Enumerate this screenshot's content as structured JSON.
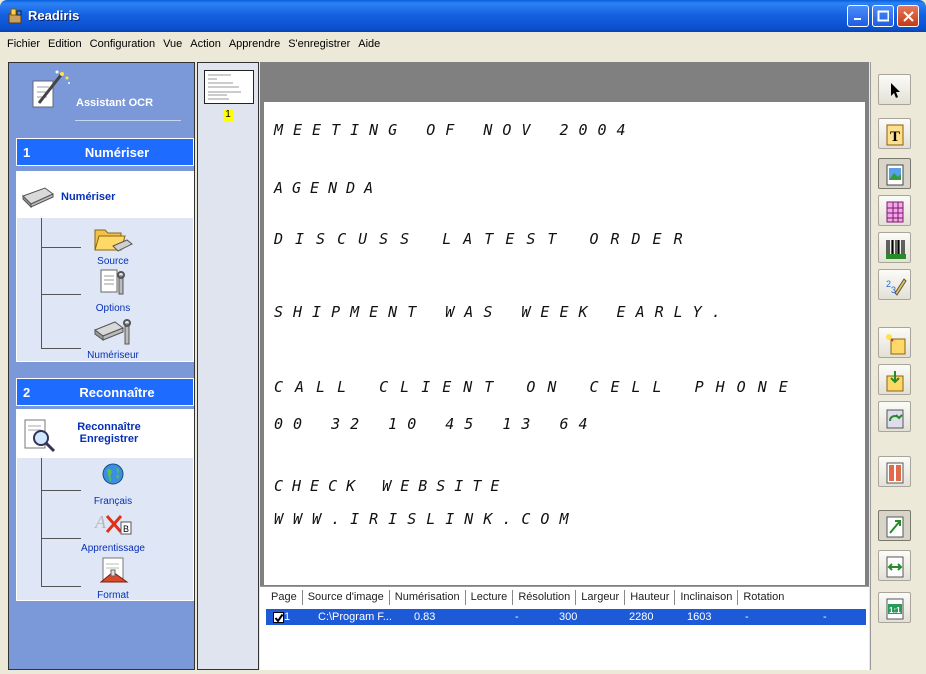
{
  "window": {
    "title": "Readiris"
  },
  "menu": [
    "Fichier",
    "Edition",
    "Configuration",
    "Vue",
    "Action",
    "Apprendre",
    "S'enregistrer",
    "Aide"
  ],
  "wizard": {
    "title": "Assistant OCR",
    "step1": {
      "number": "1",
      "title": "Numériser",
      "link": "Numériser",
      "subitems": [
        "Source",
        "Options",
        "Numériseur"
      ]
    },
    "step2": {
      "number": "2",
      "title": "Reconnaître",
      "link_line1": "Reconnaître",
      "link_line2": "Enregistrer",
      "subitems": [
        "Français",
        "Apprentissage",
        "Format"
      ]
    }
  },
  "thumbnails": {
    "page_number": "1"
  },
  "document": {
    "lines": [
      "MEETING OF NOV 2004",
      "AGENDA",
      "DISCUSS LATEST ORDER",
      "SHIPMENT WAS WEEK EARLY.",
      "CALL CLIENT ON CELL PHONE",
      "00 32 10 45 13 64",
      "CHECK WEBSITE",
      "WWW.IRISLINK.COM"
    ]
  },
  "table": {
    "headers": [
      "Page",
      "Source d'image",
      "Numérisation",
      "Lecture",
      "Résolution",
      "Largeur",
      "Hauteur",
      "Inclinaison",
      "Rotation"
    ],
    "rows": [
      {
        "page": "1",
        "source": "C:\\Program F...",
        "numerisation": "0.83",
        "lecture": "-",
        "resolution": "300",
        "largeur": "2280",
        "hauteur": "1603",
        "inclinaison": "-",
        "rotation": "-",
        "checked": true
      }
    ]
  },
  "toolbar": {
    "tools": [
      "select-arrow-icon",
      "text-zone-icon",
      "image-zone-icon",
      "table-zone-icon",
      "barcode-zone-icon",
      "handprint-zone-icon",
      "auto-zone-icon",
      "save-zones-icon",
      "load-zones-icon",
      "columns-icon",
      "fit-page-icon",
      "fit-width-icon",
      "actual-size-icon"
    ]
  }
}
